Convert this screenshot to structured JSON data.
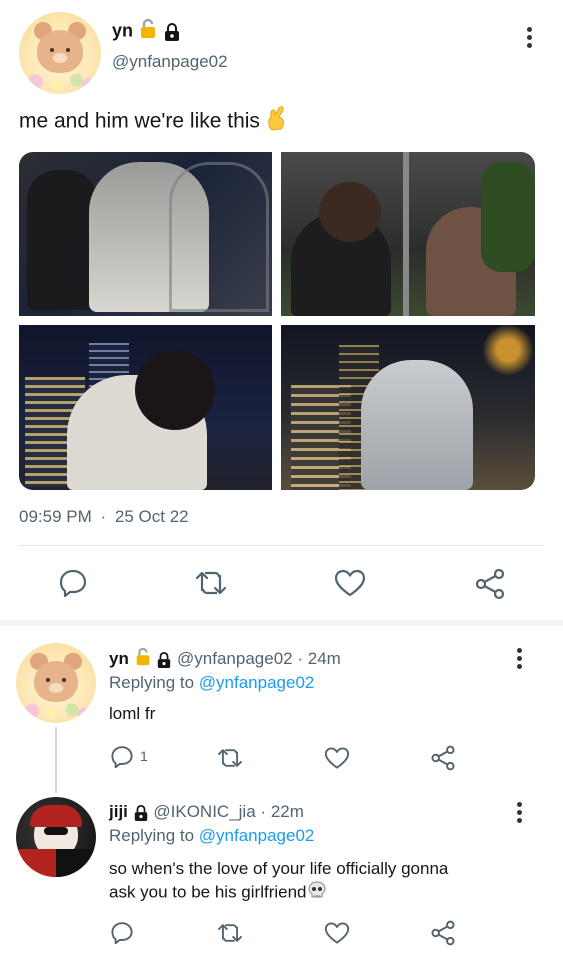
{
  "tweet": {
    "author_name": "yn",
    "handle": "@ynfanpage02",
    "text": "me and him we're like this",
    "time": "09:59 PM",
    "date_separator": "·",
    "date": "25 Oct 22",
    "icons": [
      "bear-avatar",
      "lock-emoji",
      "lock-icon",
      "crossed-fingers-emoji",
      "more-icon",
      "reply-icon",
      "retweet-icon",
      "like-icon",
      "share-icon"
    ]
  },
  "replies": [
    {
      "author_name": "yn",
      "handle": "@ynfanpage02",
      "separator": "·",
      "age": "24m",
      "replying_prefix": "Replying to",
      "replying_to": "@ynfanpage02",
      "text": "loml fr",
      "reply_count": "1"
    },
    {
      "author_name": "jiji",
      "handle": "@IKONIC_jia",
      "separator": "·",
      "age": "22m",
      "replying_prefix": "Replying to",
      "replying_to": "@ynfanpage02",
      "text_line1": "so when's the love of your life officially gonna",
      "text_line2": "ask you to be his girlfriend"
    }
  ],
  "colors": {
    "link": "#1d9bf0",
    "secondary": "#536471",
    "divider": "#e6e9ec",
    "primary": "#14171a"
  }
}
